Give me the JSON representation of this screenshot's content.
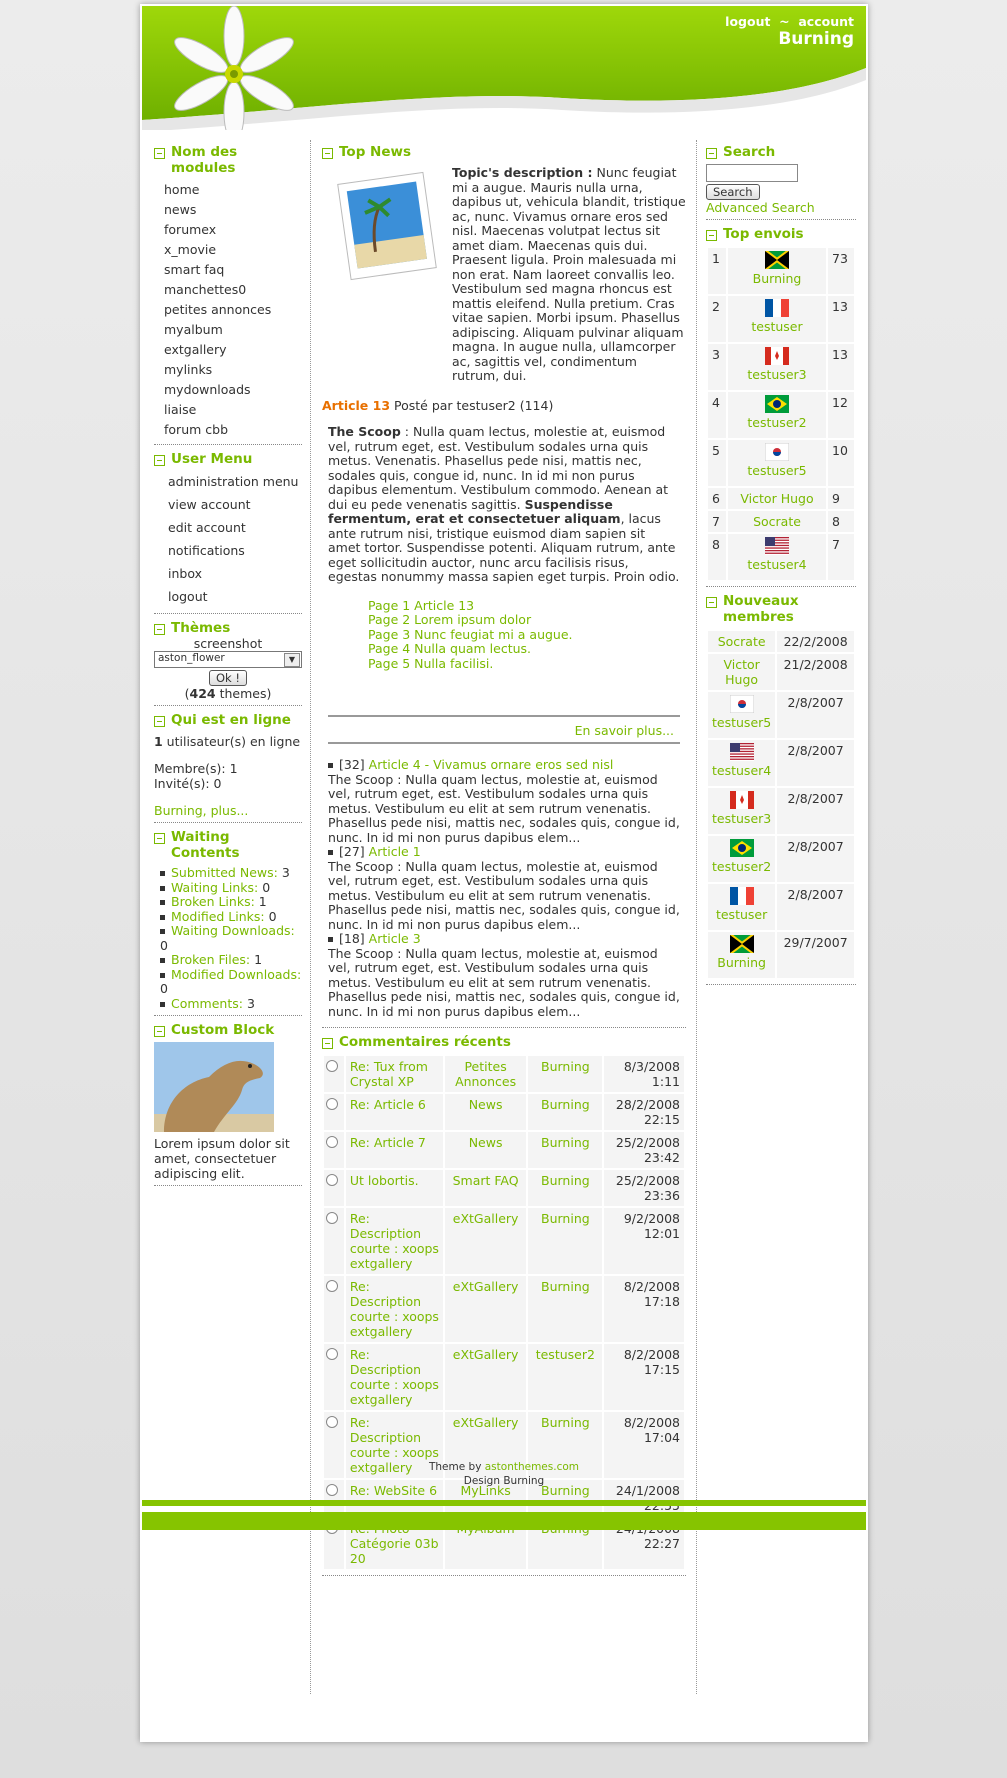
{
  "header": {
    "logout": "logout",
    "sep": "~",
    "account": "account",
    "site_name": "Burning"
  },
  "modules": {
    "title": "Nom des modules",
    "items": [
      "home",
      "news",
      "forumex",
      "x_movie",
      "smart faq",
      "manchettes0",
      "petites annonces",
      "myalbum",
      "extgallery",
      "mylinks",
      "mydownloads",
      "liaise",
      "forum cbb"
    ]
  },
  "usermenu": {
    "title": "User Menu",
    "items": [
      "administration menu",
      "view account",
      "edit account",
      "notifications",
      "inbox",
      "logout"
    ]
  },
  "themes": {
    "title": "Thèmes",
    "screenshot": "screenshot",
    "selected": "aston_flower",
    "ok": "Ok !",
    "count": "424",
    "count_suffix": " themes)",
    "count_prefix": "("
  },
  "online": {
    "title": "Qui est en ligne",
    "count": "1",
    "count_suffix": " utilisateur(s) en ligne",
    "members": "Membre(s): 1",
    "guests": "Invité(s): 0",
    "link": "Burning, plus..."
  },
  "waiting": {
    "title": "Waiting Contents",
    "items": [
      {
        "label": "Submitted News:",
        "val": " 3"
      },
      {
        "label": "Waiting Links:",
        "val": " 0"
      },
      {
        "label": "Broken Links:",
        "val": " 1"
      },
      {
        "label": "Modified Links:",
        "val": " 0"
      },
      {
        "label": "Waiting Downloads:",
        "val": " 0"
      },
      {
        "label": "Broken Files:",
        "val": " 1"
      },
      {
        "label": "Modified Downloads:",
        "val": " 0"
      },
      {
        "label": "Comments:",
        "val": " 3"
      }
    ]
  },
  "custom": {
    "title": "Custom Block",
    "text": "Lorem ipsum dolor sit amet, consectetuer adipiscing elit."
  },
  "topnews": {
    "title": "Top News",
    "desc_label": "Topic's description :",
    "desc": " Nunc feugiat mi a augue. Mauris nulla urna, dapibus ut, vehicula blandit, tristique ac, nunc. Vivamus ornare eros sed nisl. Maecenas volutpat lectus sit amet diam. Maecenas quis dui. Praesent ligula. Proin malesuada mi non erat. Nam laoreet convallis leo. Vestibulum sed magna rhoncus est mattis eleifend. Nulla pretium. Cras vitae sapien. Morbi ipsum. Phasellus adipiscing. Aliquam pulvinar aliquam magna. In augue nulla, ullamcorper ac, sagittis vel, condimentum rutrum, dui.",
    "article": "Article 13",
    "posted": " Posté par testuser2 (114)",
    "scoop_label": "The Scoop",
    "scoop1": " : Nulla quam lectus, molestie at, euismod vel, rutrum eget, est. Vestibulum sodales urna quis metus. Venenatis. Phasellus pede nisi, mattis nec, sodales quis, congue id, nunc. In id mi non purus dapibus elementum. Vestibulum commodo. Aenean at dui eu pede venenatis sagittis. ",
    "scoop_bold": "Suspendisse fermentum, erat et consectetuer aliquam",
    "scoop2": ", lacus ante rutrum nisi, tristique euismod diam sapien sit amet tortor. Suspendisse potenti. Aliquam rutrum, ante eget sollicitudin auctor, nunc arcu facilisis risus, egestas nonummy massa sapien eget turpis. Proin odio.",
    "pages": [
      "Page 1 Article 13",
      "Page 2 Lorem ipsum dolor",
      "Page 3 Nunc feugiat mi a augue.",
      "Page 4 Nulla quam lectus.",
      "Page 5 Nulla facilisi."
    ],
    "more": "En savoir plus...",
    "list": [
      {
        "count": "[32] ",
        "title": "Article 4 - Vivamus ornare eros sed nisl",
        "text": "The Scoop : Nulla quam lectus, molestie at, euismod vel, rutrum eget, est. Vestibulum sodales urna quis metus. Vestibulum eu elit at sem rutrum venenatis. Phasellus pede nisi, mattis nec, sodales quis, congue id, nunc. In id mi non purus dapibus elem..."
      },
      {
        "count": "[27] ",
        "title": "Article 1",
        "text": "The Scoop : Nulla quam lectus, molestie at, euismod vel, rutrum eget, est. Vestibulum sodales urna quis metus. Vestibulum eu elit at sem rutrum venenatis. Phasellus pede nisi, mattis nec, sodales quis, congue id, nunc. In id mi non purus dapibus elem..."
      },
      {
        "count": "[18] ",
        "title": "Article 3",
        "text": "The Scoop : Nulla quam lectus, molestie at, euismod vel, rutrum eget, est. Vestibulum sodales urna quis metus. Vestibulum eu elit at sem rutrum venenatis. Phasellus pede nisi, mattis nec, sodales quis, congue id, nunc. In id mi non purus dapibus elem..."
      }
    ]
  },
  "comments": {
    "title": "Commentaires récents",
    "rows": [
      {
        "t": "Re: Tux from Crystal XP",
        "m": "Petites Annonces",
        "u": "Burning",
        "d": "8/3/2008 1:11",
        "icon": "radio-icon"
      },
      {
        "t": "Re: Article 6",
        "m": "News",
        "u": "Burning",
        "d": "28/2/2008 22:15",
        "icon": "radio-icon"
      },
      {
        "t": "Re: Article 7",
        "m": "News",
        "u": "Burning",
        "d": "25/2/2008 23:42",
        "icon": "radio-icon"
      },
      {
        "t": "Ut lobortis.",
        "m": "Smart FAQ",
        "u": "Burning",
        "d": "25/2/2008 23:36",
        "icon": "radio-icon"
      },
      {
        "t": "Re: Description courte : xoops extgallery",
        "m": "eXtGallery",
        "u": "Burning",
        "d": "9/2/2008 12:01",
        "icon": "smiley-icon"
      },
      {
        "t": "Re: Description courte : xoops extgallery",
        "m": "eXtGallery",
        "u": "Burning",
        "d": "8/2/2008 17:18",
        "icon": "radio-icon"
      },
      {
        "t": "Re: Description courte : xoops extgallery",
        "m": "eXtGallery",
        "u": "testuser2",
        "d": "8/2/2008 17:15",
        "icon": "radio-icon"
      },
      {
        "t": "Re: Description courte : xoops extgallery",
        "m": "eXtGallery",
        "u": "Burning",
        "d": "8/2/2008 17:04",
        "icon": "radio-icon"
      },
      {
        "t": "Re: WebSite 6",
        "m": "MyLinks",
        "u": "Burning",
        "d": "24/1/2008 22:55",
        "icon": "radio-icon"
      },
      {
        "t": "Re: Photo Catégorie 03b 20",
        "m": "MyAlbum",
        "u": "Burning",
        "d": "24/1/2008 22:27",
        "icon": "radio-icon"
      }
    ]
  },
  "search": {
    "title": "Search",
    "button": "Search",
    "advanced": "Advanced Search"
  },
  "topsenders": {
    "title": "Top envois",
    "rows": [
      {
        "r": "1",
        "n": "Burning",
        "c": "73",
        "flag": "jm"
      },
      {
        "r": "2",
        "n": "testuser",
        "c": "13",
        "flag": "fr"
      },
      {
        "r": "3",
        "n": "testuser3",
        "c": "13",
        "flag": "ca"
      },
      {
        "r": "4",
        "n": "testuser2",
        "c": "12",
        "flag": "br"
      },
      {
        "r": "5",
        "n": "testuser5",
        "c": "10",
        "flag": "kr"
      },
      {
        "r": "6",
        "n": "Victor Hugo",
        "c": "9",
        "flag": ""
      },
      {
        "r": "7",
        "n": "Socrate",
        "c": "8",
        "flag": ""
      },
      {
        "r": "8",
        "n": "testuser4",
        "c": "7",
        "flag": "us"
      }
    ]
  },
  "newmembers": {
    "title": "Nouveaux membres",
    "rows": [
      {
        "n": "Socrate",
        "d": "22/2/2008",
        "flag": ""
      },
      {
        "n": "Victor Hugo",
        "d": "21/2/2008",
        "flag": ""
      },
      {
        "n": "testuser5",
        "d": "2/8/2007",
        "flag": "kr"
      },
      {
        "n": "testuser4",
        "d": "2/8/2007",
        "flag": "us"
      },
      {
        "n": "testuser3",
        "d": "2/8/2007",
        "flag": "ca"
      },
      {
        "n": "testuser2",
        "d": "2/8/2007",
        "flag": "br"
      },
      {
        "n": "testuser",
        "d": "2/8/2007",
        "flag": "fr"
      },
      {
        "n": "Burning",
        "d": "29/7/2007",
        "flag": "jm"
      }
    ]
  },
  "footer": {
    "theme_by": "Theme by ",
    "theme_link": "astonthemes.com",
    "design": "Design Burning"
  },
  "colors": {
    "accent": "#7ab900",
    "header_green": "#86c400"
  }
}
